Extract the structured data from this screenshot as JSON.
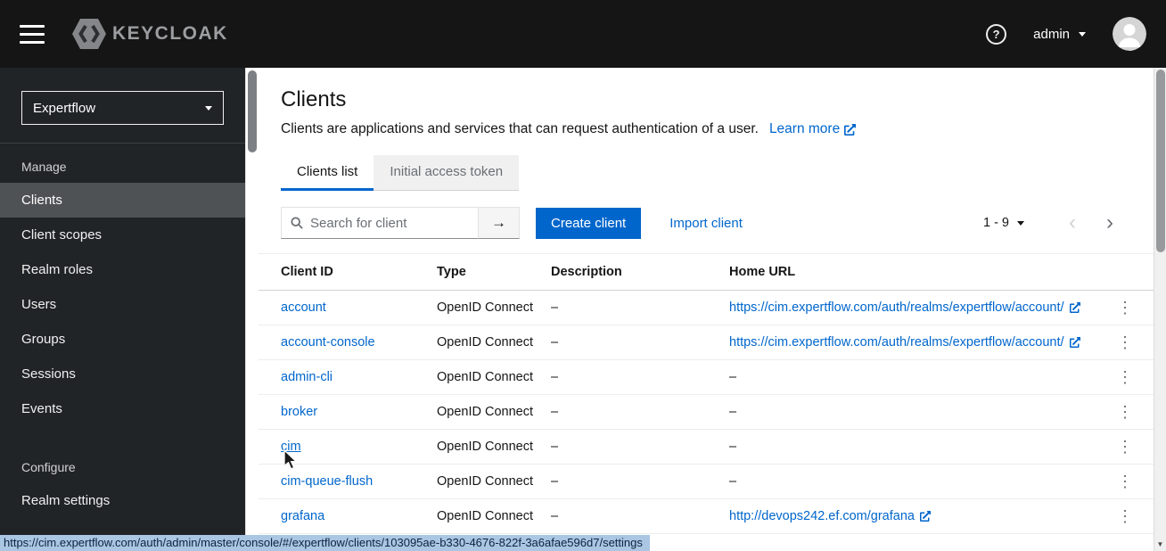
{
  "colors": {
    "accent": "#0066cc",
    "link": "#0066cc",
    "header_bg": "#151515",
    "sidebar_bg": "#212427",
    "sidebar_selected_bg": "#4f5255",
    "tab_inactive_bg": "#f0f0f0",
    "status_highlight": "#a9c6e3"
  },
  "icons": {
    "help": "?",
    "search_submit": "→",
    "kebab": "⋮",
    "prev": "‹",
    "next": "›",
    "scroll_down": "▼"
  },
  "header": {
    "brand": "KEYCLOAK",
    "user": "admin"
  },
  "sidebar": {
    "realm": "Expertflow",
    "sections": [
      {
        "label": "Manage",
        "items": [
          {
            "label": "Clients",
            "selected": true
          },
          {
            "label": "Client scopes"
          },
          {
            "label": "Realm roles"
          },
          {
            "label": "Users"
          },
          {
            "label": "Groups"
          },
          {
            "label": "Sessions"
          },
          {
            "label": "Events"
          }
        ]
      },
      {
        "label": "Configure",
        "items": [
          {
            "label": "Realm settings"
          }
        ]
      }
    ]
  },
  "main": {
    "title": "Clients",
    "subtitle": "Clients are applications and services that can request authentication of a user.",
    "learn_more_label": "Learn more",
    "tabs": [
      {
        "label": "Clients list",
        "active": true
      },
      {
        "label": "Initial access token",
        "active": false
      }
    ],
    "toolbar": {
      "search_placeholder": "Search for client",
      "create_label": "Create client",
      "import_label": "Import client",
      "pagination_label": "1 - 9"
    },
    "table": {
      "columns": [
        "Client ID",
        "Type",
        "Description",
        "Home URL"
      ],
      "rows": [
        {
          "client_id": "account",
          "type": "OpenID Connect",
          "description": "–",
          "home_url": "https://cim.expertflow.com/auth/realms/expertflow/account/"
        },
        {
          "client_id": "account-console",
          "type": "OpenID Connect",
          "description": "–",
          "home_url": "https://cim.expertflow.com/auth/realms/expertflow/account/"
        },
        {
          "client_id": "admin-cli",
          "type": "OpenID Connect",
          "description": "–",
          "home_url": "–"
        },
        {
          "client_id": "broker",
          "type": "OpenID Connect",
          "description": "–",
          "home_url": "–"
        },
        {
          "client_id": "cim",
          "type": "OpenID Connect",
          "description": "–",
          "home_url": "–"
        },
        {
          "client_id": "cim-queue-flush",
          "type": "OpenID Connect",
          "description": "–",
          "home_url": "–"
        },
        {
          "client_id": "grafana",
          "type": "OpenID Connect",
          "description": "–",
          "home_url": "http://devops242.ef.com/grafana"
        }
      ]
    }
  },
  "status_bar": {
    "url": "https://cim.expertflow.com/auth/admin/master/console/#/expertflow/clients/103095ae-b330-4676-822f-3a6afae596d7/settings"
  }
}
